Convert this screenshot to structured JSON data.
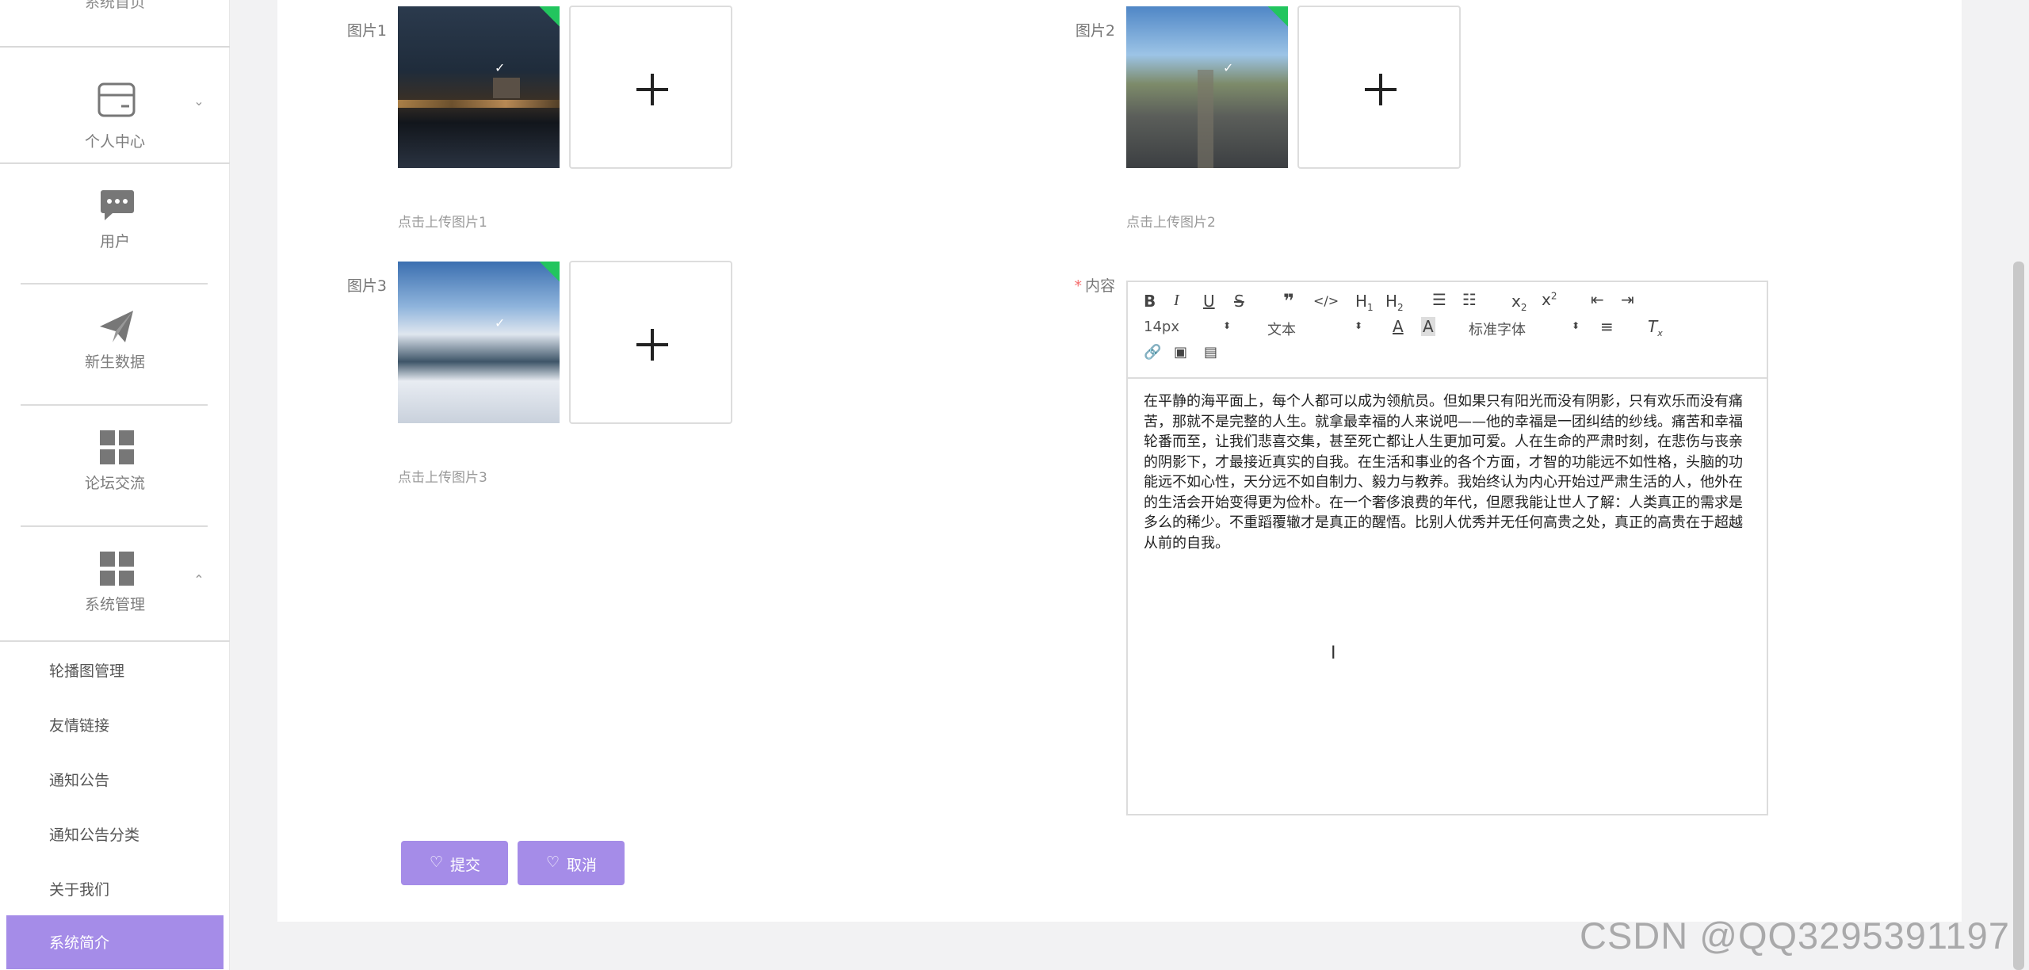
{
  "sidebar": {
    "top_item": "系统首页",
    "items": [
      {
        "label": "个人中心",
        "icon": "wallet-icon"
      },
      {
        "label": "用户",
        "icon": "chat-icon"
      },
      {
        "label": "新生数据",
        "icon": "send-icon"
      },
      {
        "label": "论坛交流",
        "icon": "grid-icon"
      },
      {
        "label": "系统管理",
        "icon": "grid-icon"
      }
    ],
    "sub_items": [
      "轮播图管理",
      "友情链接",
      "通知公告",
      "通知公告分类",
      "关于我们"
    ],
    "active_sub": "系统简介"
  },
  "form": {
    "image1": {
      "label": "图片1",
      "hint": "点击上传图片1"
    },
    "image2": {
      "label": "图片2",
      "hint": "点击上传图片2"
    },
    "image3": {
      "label": "图片3",
      "hint": "点击上传图片3"
    },
    "content_label": "内容",
    "content_required": "*"
  },
  "editor": {
    "font_size": "14px",
    "text_type": "文本",
    "font_family": "标准字体",
    "lines": [
      "在平静的海平面上，每个人都可以成为领航员。但如果只有阳光而没有阴影，只有欢乐而没有痛",
      "苦，那就不是完整的人生。就拿最幸福的人来说吧——他的幸福是一团纠结的纱线。痛苦和幸福",
      "轮番而至，让我们悲喜交集，甚至死亡都让人生更加可爱。人在生命的严肃时刻，在悲伤与丧亲",
      "的阴影下，才最接近真实的自我。在生活和事业的各个方面，才智的功能远不如性格，头脑的功",
      "能远不如心性，天分远不如自制力、毅力与教养。我始终认为内心开始过严肃生活的人，他外在",
      "的生活会开始变得更为俭朴。在一个奢侈浪费的年代，但愿我能让世人了解：人类真正的需求是",
      "多么的稀少。不重蹈覆辙才是真正的醒悟。比别人优秀并无任何高贵之处，真正的高贵在于超越",
      "从前的自我。"
    ]
  },
  "buttons": {
    "submit": "提交",
    "cancel": "取消"
  },
  "watermark": "CSDN @QQ3295391197",
  "colors": {
    "accent": "#a58ce8",
    "badge": "#22c55e"
  }
}
